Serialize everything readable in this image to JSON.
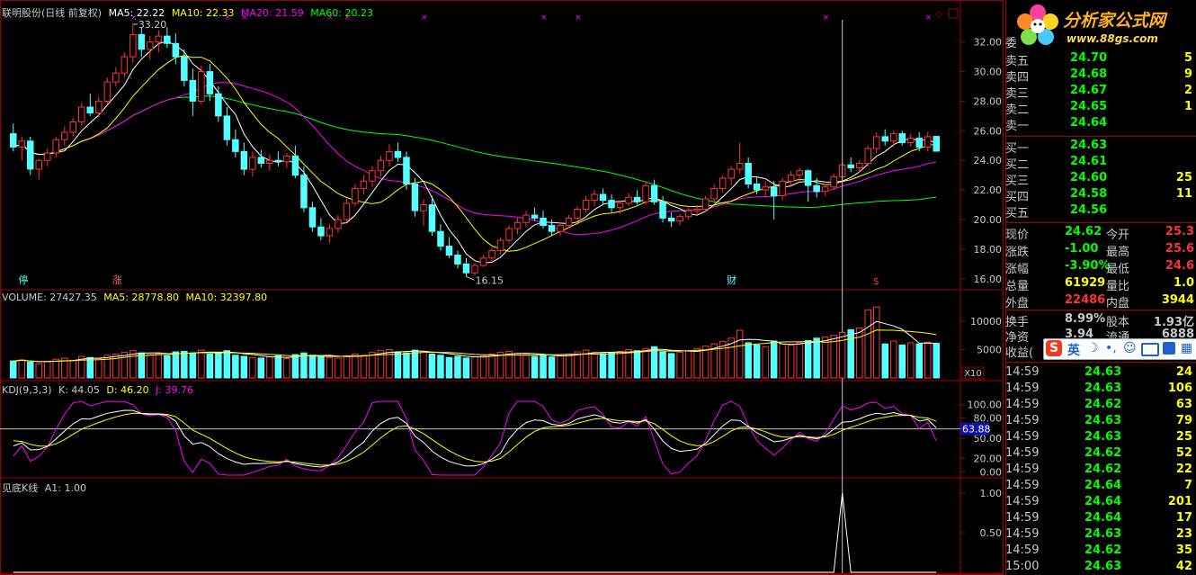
{
  "header": {
    "stock": "联明股份(日线 前复权)",
    "ma5": "MA5: 22.22",
    "ma10": "MA10: 22.33",
    "ma20": "MA20: 21.59",
    "ma60": "MA60: 20.23"
  },
  "price_axis": [
    "32.00",
    "30.00",
    "28.00",
    "26.00",
    "24.00",
    "22.00",
    "20.00",
    "18.00",
    "16.00"
  ],
  "price_marks": {
    "high": "33.20",
    "low": "16.15",
    "stop": "停",
    "rise": "涨",
    "fin": "财",
    "dollar": "$"
  },
  "volume": {
    "title": "VOLUME: 27427.35",
    "ma5": "MA5: 28778.80",
    "ma10": "MA10: 32397.80",
    "axis": [
      "10000",
      "5000"
    ],
    "unit": "X10"
  },
  "kdj": {
    "title": "KDJ(9,3,3)",
    "k": "K: 44.05",
    "d": "D: 46.20",
    "j": "J: 39.76",
    "axis": [
      "100.00",
      "80.00",
      "50.00",
      "20.00",
      "0.00"
    ],
    "current": "63.88"
  },
  "signal": {
    "title": "见底K线",
    "a1": "A1: 1.00",
    "axis": [
      "1.00",
      "0.50"
    ]
  },
  "logo": {
    "name": "分析家公式网",
    "url": "www.88gs.com"
  },
  "ime": {
    "label": "英"
  },
  "quote": {
    "sell": [
      {
        "label": "卖五",
        "price": "24.70",
        "vol": "5"
      },
      {
        "label": "卖四",
        "price": "24.68",
        "vol": "9"
      },
      {
        "label": "卖三",
        "price": "24.67",
        "vol": "2"
      },
      {
        "label": "卖二",
        "price": "24.65",
        "vol": "1"
      },
      {
        "label": "卖一",
        "price": "24.64",
        "vol": ""
      }
    ],
    "buy": [
      {
        "label": "买一",
        "price": "24.63",
        "vol": ""
      },
      {
        "label": "买二",
        "price": "24.61",
        "vol": ""
      },
      {
        "label": "买三",
        "price": "24.60",
        "vol": "25"
      },
      {
        "label": "买四",
        "price": "24.58",
        "vol": "11"
      },
      {
        "label": "买五",
        "price": "24.56",
        "vol": ""
      }
    ],
    "stats": [
      {
        "l1": "现价",
        "v1": "24.62",
        "l2": "今开",
        "v2": "25.3"
      },
      {
        "l1": "涨跌",
        "v1": "-1.00",
        "l2": "最高",
        "v2": "25.6"
      },
      {
        "l1": "涨幅",
        "v1": "-3.90%",
        "l2": "最低",
        "v2": "24.6"
      },
      {
        "l1": "总量",
        "v1": "61929",
        "l2": "量比",
        "v2": "1.0"
      },
      {
        "l1": "外盘",
        "v1": "22486",
        "l2": "内盘",
        "v2": "3944"
      }
    ],
    "stats2": [
      {
        "l1": "换手",
        "v1": "8.99%",
        "l2": "股本",
        "v2": "1.93亿"
      },
      {
        "l1": "净资",
        "v1": "3.94",
        "l2": "流通",
        "v2": "6888"
      },
      {
        "l1": "收益(",
        "v1": "",
        "l2": "",
        "v2": ""
      }
    ],
    "ticks": [
      {
        "t": "14:59",
        "p": "24.63",
        "v": "24",
        "c": "up"
      },
      {
        "t": "14:59",
        "p": "24.63",
        "v": "106",
        "c": "up"
      },
      {
        "t": "14:59",
        "p": "24.62",
        "v": "63",
        "c": "down"
      },
      {
        "t": "14:59",
        "p": "24.63",
        "v": "79",
        "c": "up"
      },
      {
        "t": "14:59",
        "p": "24.63",
        "v": "25",
        "c": "up"
      },
      {
        "t": "14:59",
        "p": "24.62",
        "v": "52",
        "c": "down"
      },
      {
        "t": "14:59",
        "p": "24.62",
        "v": "22",
        "c": "down"
      },
      {
        "t": "14:59",
        "p": "24.64",
        "v": "7",
        "c": "up"
      },
      {
        "t": "14:59",
        "p": "24.64",
        "v": "201",
        "c": "up"
      },
      {
        "t": "14:59",
        "p": "24.64",
        "v": "17",
        "c": "up"
      },
      {
        "t": "14:59",
        "p": "24.63",
        "v": "23",
        "c": "down"
      },
      {
        "t": "14:59",
        "p": "24.62",
        "v": "35",
        "c": "down"
      },
      {
        "t": "15:00",
        "p": "24.63",
        "v": "42",
        "c": "up"
      }
    ]
  },
  "colors": {
    "up": "#ff3232",
    "down": "#54ffff",
    "ma5": "#ffffff",
    "ma10": "#ffff00",
    "ma20": "#ff00ff",
    "ma60": "#00ff00",
    "grid": "#a00000",
    "label": "#c8c8c8"
  },
  "chart_data": {
    "type": "candlestick",
    "ylim": [
      15.5,
      33.5
    ],
    "candles": [
      [
        25.8,
        26.5,
        24.6,
        24.9
      ],
      [
        24.9,
        25.6,
        24.0,
        25.3
      ],
      [
        25.3,
        25.6,
        23.0,
        23.4
      ],
      [
        23.4,
        24.1,
        22.7,
        24.0
      ],
      [
        24.0,
        24.8,
        23.6,
        24.5
      ],
      [
        24.5,
        25.6,
        24.2,
        25.4
      ],
      [
        25.4,
        26.3,
        25.0,
        25.9
      ],
      [
        25.9,
        26.9,
        25.6,
        26.6
      ],
      [
        26.6,
        27.9,
        26.3,
        27.6
      ],
      [
        27.6,
        28.5,
        27.0,
        27.2
      ],
      [
        27.2,
        28.3,
        26.9,
        28.0
      ],
      [
        28.0,
        29.6,
        27.8,
        29.3
      ],
      [
        29.3,
        30.3,
        29.0,
        29.9
      ],
      [
        29.9,
        31.3,
        29.6,
        31.0
      ],
      [
        31.0,
        33.2,
        30.6,
        32.5
      ],
      [
        32.5,
        33.0,
        31.0,
        31.5
      ],
      [
        31.5,
        32.4,
        30.8,
        32.0
      ],
      [
        32.0,
        32.8,
        31.3,
        32.4
      ],
      [
        32.4,
        33.0,
        31.6,
        31.9
      ],
      [
        31.9,
        32.6,
        30.5,
        31.0
      ],
      [
        31.0,
        31.5,
        29.0,
        29.4
      ],
      [
        29.4,
        30.2,
        27.0,
        28.0
      ],
      [
        28.0,
        30.4,
        27.8,
        30.0
      ],
      [
        30.0,
        30.5,
        28.0,
        28.5
      ],
      [
        28.5,
        29.0,
        26.6,
        27.0
      ],
      [
        27.0,
        27.6,
        25.0,
        25.4
      ],
      [
        25.4,
        26.1,
        24.2,
        24.6
      ],
      [
        24.6,
        25.2,
        23.0,
        23.4
      ],
      [
        23.4,
        24.6,
        22.9,
        24.2
      ],
      [
        24.2,
        24.7,
        23.5,
        23.8
      ],
      [
        23.8,
        24.4,
        23.3,
        24.0
      ],
      [
        24.0,
        24.6,
        23.6,
        23.9
      ],
      [
        23.9,
        24.5,
        23.5,
        24.3
      ],
      [
        24.3,
        25.0,
        22.8,
        23.0
      ],
      [
        23.0,
        23.6,
        20.5,
        20.8
      ],
      [
        20.8,
        21.2,
        19.2,
        19.5
      ],
      [
        19.5,
        20.1,
        18.6,
        18.9
      ],
      [
        18.9,
        19.7,
        18.4,
        19.4
      ],
      [
        19.4,
        20.3,
        19.1,
        20.0
      ],
      [
        20.0,
        21.4,
        19.8,
        21.1
      ],
      [
        21.1,
        22.4,
        20.9,
        22.1
      ],
      [
        22.1,
        23.0,
        21.7,
        22.6
      ],
      [
        22.6,
        23.6,
        22.2,
        23.3
      ],
      [
        23.3,
        24.3,
        22.9,
        24.0
      ],
      [
        24.0,
        25.1,
        23.6,
        24.6
      ],
      [
        24.6,
        25.2,
        23.9,
        24.2
      ],
      [
        24.2,
        24.6,
        22.0,
        22.4
      ],
      [
        22.4,
        22.8,
        20.2,
        20.6
      ],
      [
        20.6,
        21.4,
        19.6,
        21.0
      ],
      [
        21.0,
        21.6,
        18.9,
        19.2
      ],
      [
        19.2,
        19.7,
        17.9,
        18.2
      ],
      [
        18.2,
        18.8,
        17.4,
        17.6
      ],
      [
        17.6,
        17.9,
        16.7,
        17.0
      ],
      [
        17.0,
        17.4,
        16.15,
        16.4
      ],
      [
        16.4,
        17.1,
        16.2,
        16.9
      ],
      [
        16.9,
        17.6,
        16.8,
        17.4
      ],
      [
        17.4,
        18.1,
        17.2,
        17.9
      ],
      [
        17.9,
        18.8,
        17.7,
        18.6
      ],
      [
        18.6,
        19.6,
        18.4,
        19.4
      ],
      [
        19.4,
        20.1,
        19.0,
        19.8
      ],
      [
        19.8,
        20.6,
        19.5,
        20.3
      ],
      [
        20.3,
        20.8,
        19.9,
        20.1
      ],
      [
        20.1,
        20.6,
        19.4,
        19.6
      ],
      [
        19.6,
        20.0,
        18.9,
        19.2
      ],
      [
        19.2,
        19.8,
        18.9,
        19.6
      ],
      [
        19.6,
        20.3,
        19.4,
        20.1
      ],
      [
        20.1,
        20.9,
        19.9,
        20.7
      ],
      [
        20.7,
        21.6,
        20.5,
        21.3
      ],
      [
        21.3,
        22.0,
        20.9,
        21.7
      ],
      [
        21.7,
        22.1,
        21.0,
        21.3
      ],
      [
        21.3,
        21.7,
        20.5,
        20.8
      ],
      [
        20.8,
        21.3,
        20.4,
        21.1
      ],
      [
        21.1,
        21.8,
        20.9,
        21.5
      ],
      [
        21.5,
        22.0,
        21.0,
        21.2
      ],
      [
        21.2,
        22.6,
        21.0,
        22.3
      ],
      [
        22.3,
        22.7,
        21.0,
        21.2
      ],
      [
        21.2,
        21.6,
        19.8,
        20.1
      ],
      [
        20.1,
        20.5,
        19.5,
        19.9
      ],
      [
        19.9,
        20.4,
        19.6,
        20.2
      ],
      [
        20.2,
        20.8,
        20.0,
        20.6
      ],
      [
        20.6,
        21.0,
        20.3,
        20.7
      ],
      [
        20.7,
        21.6,
        20.5,
        21.4
      ],
      [
        21.4,
        22.4,
        21.1,
        22.1
      ],
      [
        22.1,
        23.0,
        21.8,
        22.8
      ],
      [
        22.8,
        23.6,
        22.3,
        23.4
      ],
      [
        23.4,
        25.2,
        23.1,
        23.8
      ],
      [
        23.8,
        24.2,
        22.1,
        22.4
      ],
      [
        22.4,
        22.9,
        21.7,
        22.0
      ],
      [
        22.0,
        22.6,
        21.5,
        22.2
      ],
      [
        22.2,
        22.6,
        20.0,
        21.6
      ],
      [
        21.6,
        22.8,
        21.3,
        22.6
      ],
      [
        22.6,
        23.3,
        22.2,
        23.0
      ],
      [
        23.0,
        23.5,
        22.6,
        23.3
      ],
      [
        23.3,
        23.4,
        21.2,
        22.3
      ],
      [
        22.3,
        22.8,
        21.5,
        21.9
      ],
      [
        21.9,
        22.4,
        21.6,
        22.2
      ],
      [
        22.2,
        23.1,
        22.0,
        22.9
      ],
      [
        22.9,
        23.9,
        22.7,
        23.7
      ],
      [
        23.7,
        24.2,
        23.2,
        23.5
      ],
      [
        23.5,
        24.0,
        23.2,
        23.8
      ],
      [
        23.8,
        25.0,
        23.6,
        24.8
      ],
      [
        24.8,
        25.9,
        24.5,
        25.6
      ],
      [
        25.6,
        26.1,
        25.0,
        25.3
      ],
      [
        25.3,
        26.0,
        24.9,
        25.8
      ],
      [
        25.8,
        26.0,
        25.0,
        25.2
      ],
      [
        25.2,
        25.8,
        24.9,
        25.5
      ],
      [
        25.5,
        25.9,
        24.6,
        24.9
      ],
      [
        24.9,
        25.9,
        24.6,
        25.6
      ],
      [
        25.62,
        25.65,
        24.6,
        24.62
      ]
    ],
    "volume": [
      30,
      32,
      28,
      25,
      29,
      33,
      35,
      31,
      38,
      36,
      34,
      40,
      42,
      45,
      48,
      44,
      41,
      43,
      39,
      46,
      47,
      44,
      49,
      42,
      45,
      48,
      40,
      38,
      36,
      35,
      37,
      39,
      34,
      41,
      44,
      40,
      38,
      36,
      35,
      39,
      42,
      40,
      45,
      48,
      50,
      46,
      44,
      49,
      47,
      42,
      40,
      36,
      38,
      35,
      37,
      39,
      42,
      45,
      47,
      43,
      41,
      38,
      40,
      37,
      39,
      42,
      46,
      49,
      45,
      43,
      44,
      47,
      50,
      48,
      52,
      55,
      46,
      43,
      45,
      48,
      52,
      56,
      60,
      64,
      70,
      84,
      62,
      58,
      55,
      65,
      60,
      58,
      62,
      66,
      70,
      72,
      75,
      80,
      85,
      88,
      120,
      125,
      60,
      65,
      58,
      62,
      60,
      63,
      61
    ],
    "signal_index": 97
  }
}
